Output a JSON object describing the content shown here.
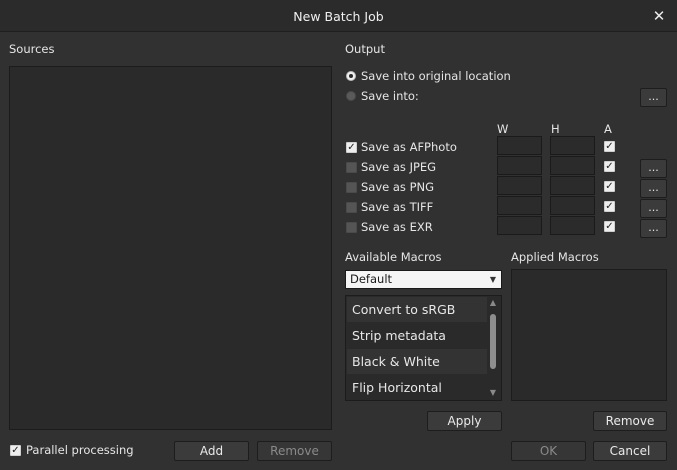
{
  "window": {
    "title": "New Batch Job"
  },
  "sources": {
    "label": "Sources"
  },
  "output": {
    "label": "Output",
    "radio_original": "Save into original location",
    "radio_into": "Save into:",
    "browse_label": "...",
    "col_w": "W",
    "col_h": "H",
    "col_a": "A",
    "formats": [
      {
        "label": "Save as AFPhoto",
        "checked": true,
        "a_checked": true,
        "has_browse": false
      },
      {
        "label": "Save as JPEG",
        "checked": false,
        "a_checked": true,
        "has_browse": true
      },
      {
        "label": "Save as PNG",
        "checked": false,
        "a_checked": true,
        "has_browse": true
      },
      {
        "label": "Save as TIFF",
        "checked": false,
        "a_checked": true,
        "has_browse": true
      },
      {
        "label": "Save as EXR",
        "checked": false,
        "a_checked": true,
        "has_browse": true
      }
    ]
  },
  "macros": {
    "available_label": "Available Macros",
    "applied_label": "Applied Macros",
    "category_selected": "Default",
    "items": [
      "Convert to sRGB",
      "Strip metadata",
      "Black & White",
      "Flip Horizontal"
    ],
    "apply_label": "Apply",
    "remove_label": "Remove"
  },
  "footer": {
    "parallel_label": "Parallel processing",
    "parallel_checked": true,
    "add_label": "Add",
    "remove_label": "Remove",
    "ok_label": "OK",
    "cancel_label": "Cancel"
  },
  "icons": {
    "close": "close-icon",
    "check": "checkmark-icon",
    "dropdown": "chevron-down-icon",
    "scroll_up": "scroll-up-arrow-icon",
    "scroll_down": "scroll-down-arrow-icon"
  },
  "colors": {
    "background": "#313131",
    "panel": "#2a2a2a",
    "titlebar": "#2b2b2b",
    "text": "#e6e6e6"
  }
}
